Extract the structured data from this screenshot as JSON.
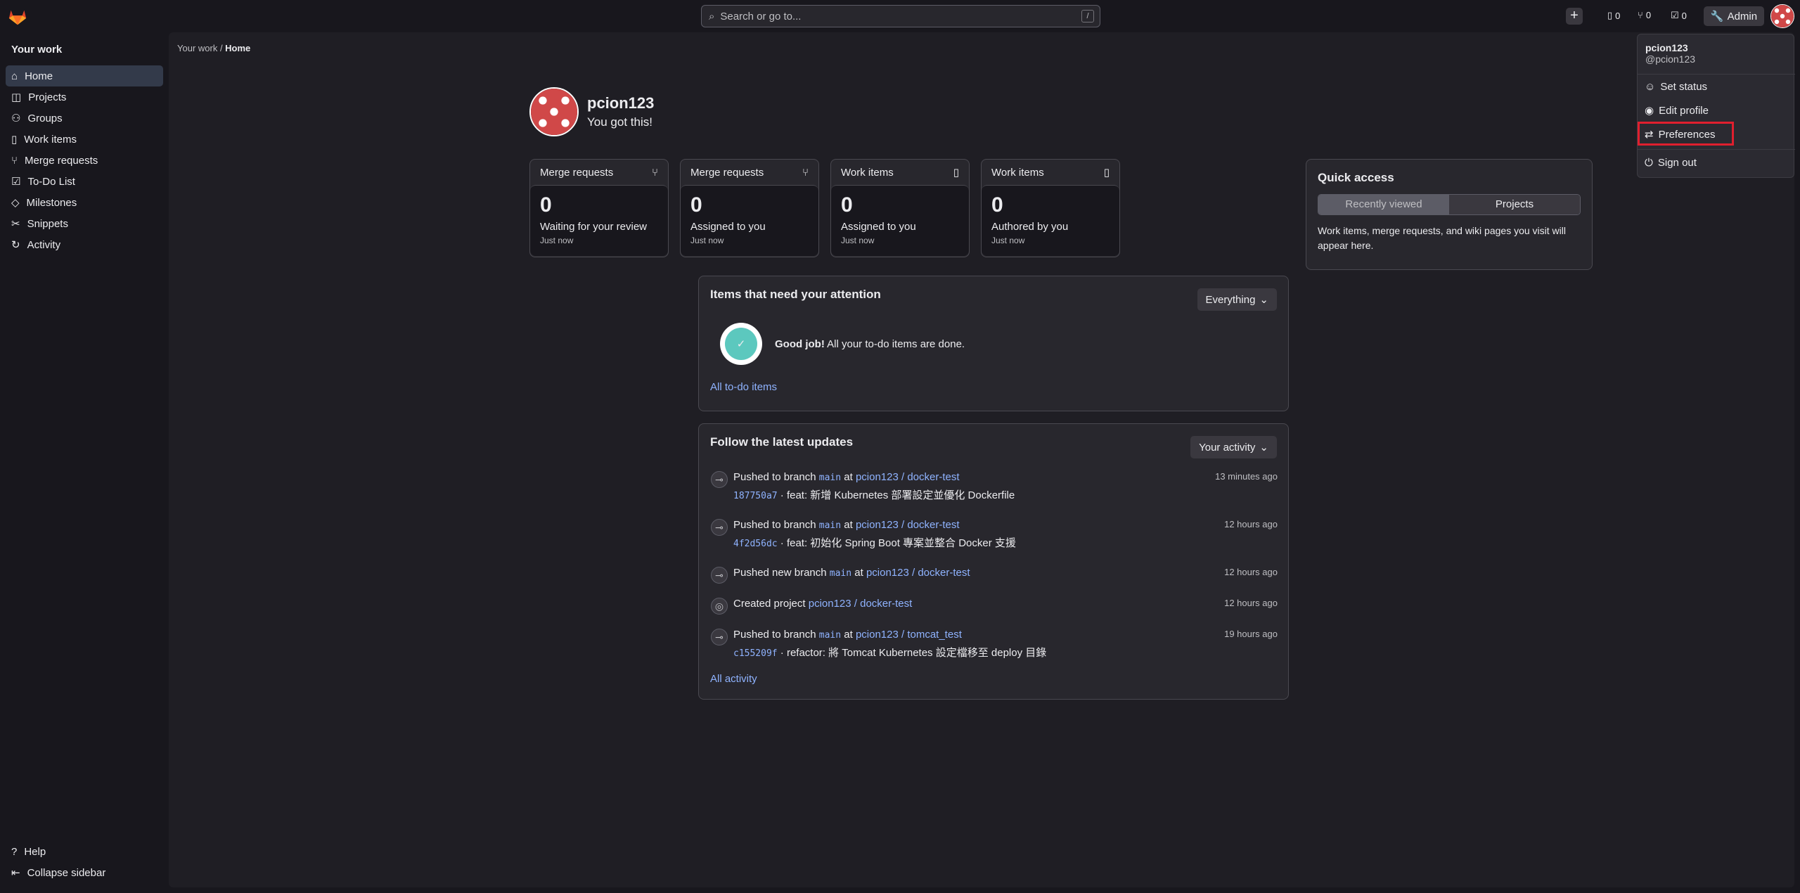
{
  "header": {
    "search_placeholder": "Search or go to...",
    "shortcut": "/",
    "counts": {
      "issues": "0",
      "merge_requests": "0",
      "todos": "0"
    },
    "admin": "Admin"
  },
  "sidebar": {
    "title": "Your work",
    "items": [
      "Home",
      "Projects",
      "Groups",
      "Work items",
      "Merge requests",
      "To-Do List",
      "Milestones",
      "Snippets",
      "Activity"
    ],
    "bottom": [
      "Help",
      "Collapse sidebar"
    ]
  },
  "breadcrumb": {
    "parent": "Your work",
    "current": "Home"
  },
  "profile": {
    "name": "pcion123",
    "status": "You got this!"
  },
  "metrics": [
    {
      "title": "Merge requests",
      "value": "0",
      "label": "Waiting for your review",
      "time": "Just now",
      "icon": "merge-request-icon"
    },
    {
      "title": "Merge requests",
      "value": "0",
      "label": "Assigned to you",
      "time": "Just now",
      "icon": "merge-request-icon"
    },
    {
      "title": "Work items",
      "value": "0",
      "label": "Assigned to you",
      "time": "Just now",
      "icon": "work-item-icon"
    },
    {
      "title": "Work items",
      "value": "0",
      "label": "Authored by you",
      "time": "Just now",
      "icon": "work-item-icon"
    }
  ],
  "quick_access": {
    "title": "Quick access",
    "tabs": [
      "Recently viewed",
      "Projects"
    ],
    "message": "Work items, merge requests, and wiki pages you visit will appear here."
  },
  "attention": {
    "title": "Items that need your attention",
    "filter": "Everything",
    "good": "Good job!",
    "message": "All your to-do items are done.",
    "link": "All to-do items"
  },
  "updates": {
    "title": "Follow the latest updates",
    "filter": "Your activity",
    "link": "All activity",
    "items": [
      {
        "action": "Pushed to branch",
        "branch": "main",
        "at": "at",
        "project": "pcion123 / docker-test",
        "time": "13 minutes ago",
        "hash": "187750a7",
        "message": " · feat: 新增 Kubernetes 部署設定並優化 Dockerfile"
      },
      {
        "action": "Pushed to branch",
        "branch": "main",
        "at": "at",
        "project": "pcion123 / docker-test",
        "time": "12 hours ago",
        "hash": "4f2d56dc",
        "message": " · feat: 初始化 Spring Boot 專案並整合 Docker 支援"
      },
      {
        "action": "Pushed new branch",
        "branch": "main",
        "at": "at",
        "project": "pcion123 / docker-test",
        "time": "12 hours ago"
      },
      {
        "action": "Created project",
        "project": "pcion123 / docker-test",
        "time": "12 hours ago"
      },
      {
        "action": "Pushed to branch",
        "branch": "main",
        "at": "at",
        "project": "pcion123 / tomcat_test",
        "time": "19 hours ago",
        "hash": "c155209f",
        "message": " · refactor: 將 Tomcat Kubernetes 設定檔移至 deploy 目錄"
      }
    ]
  },
  "user_menu": {
    "name": "pcion123",
    "username": "@pcion123",
    "items": [
      "Set status",
      "Edit profile",
      "Preferences",
      "Sign out"
    ]
  }
}
